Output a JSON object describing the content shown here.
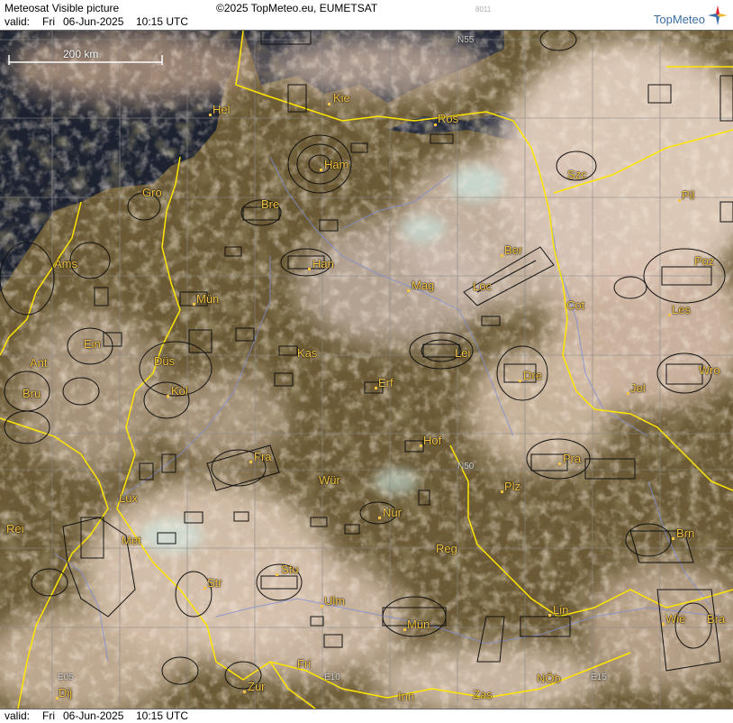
{
  "header": {
    "title": "Meteosat Visible picture",
    "copyright": "©2025 TopMeteo.eu, EUMETSAT",
    "code": "8011",
    "valid_prefix": "valid:",
    "valid_day": "Fri",
    "valid_date": "06-Jun-2025",
    "valid_time": "10:15 UTC",
    "logo_text": "TopMeteo"
  },
  "footer": {
    "valid_prefix": "valid:",
    "valid_day": "Fri",
    "valid_date": "06-Jun-2025",
    "valid_time": "10:15 UTC"
  },
  "scale_label": "200 km",
  "grid_labels": {
    "n55": "N55",
    "n50": "N50",
    "e05": "E05",
    "e10": "E10",
    "e15": "E15"
  },
  "cities": {
    "hel": "Hel",
    "kie": "Kie",
    "ros": "Ros",
    "ham": "Ham",
    "szc": "Szc",
    "gro": "Gro",
    "bre": "Bre",
    "pil": "Pil",
    "ams": "Ams",
    "han": "Han",
    "ber": "Ber",
    "mag": "Mag",
    "loc": "Loc",
    "poz": "Poz",
    "mun_n": "Mün",
    "cot": "Cot",
    "les": "Les",
    "ein": "Ein",
    "dus": "Düs",
    "kas": "Kas",
    "lei": "Lei",
    "ant": "Ant",
    "bru": "Bru",
    "kol": "Köl",
    "erf": "Erf",
    "dre": "Dre",
    "wro": "Wro",
    "jel": "Jel",
    "hof": "Hof",
    "fra": "Fra",
    "pra": "Pra",
    "wur": "Wür",
    "plz": "Plz",
    "lux": "Lux",
    "nur": "Nür",
    "rei": "Rei",
    "met": "Met",
    "reg": "Reg",
    "brn": "Brn",
    "stu": "Stu",
    "str": "Str",
    "ulm": "Ulm",
    "lin": "Lin",
    "mun_s": "Mün",
    "wie": "Wie",
    "bra": "Bra",
    "fri": "Fri",
    "dij": "Dij",
    "zur": "Zür",
    "nob": "NÖb",
    "inn": "Inn",
    "zas": "Zas"
  },
  "colors": {
    "sea": "#1c2230",
    "land": "#6b5a35",
    "cloud": "#d8c2ad",
    "border": "#ffe600",
    "river": "#7f8fd6",
    "city": "#f5c542"
  }
}
